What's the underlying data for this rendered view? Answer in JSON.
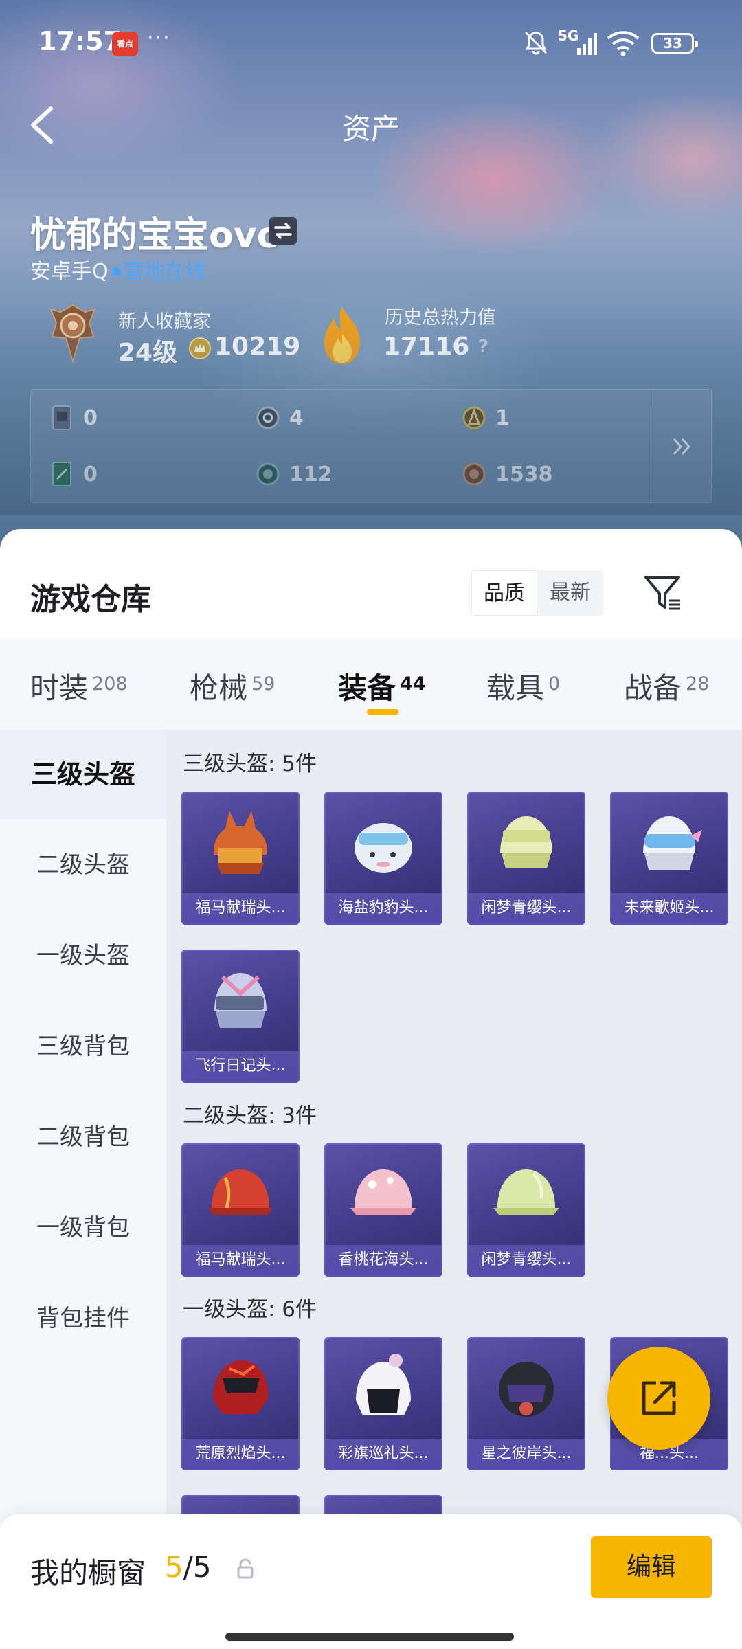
{
  "status_bar": {
    "time": "17:57",
    "app_badge": "看点",
    "more": "···",
    "network": "5G",
    "battery": "33"
  },
  "header": {
    "title": "资产"
  },
  "profile": {
    "name": "忧郁的宝宝ovo",
    "account": "安卓手Q",
    "online_status": "营地在线",
    "rank_title": "新人收藏家",
    "level": "24级",
    "coins": "10219",
    "heat_title": "历史总热力值",
    "heat_value": "17116",
    "help": "?"
  },
  "stats": [
    {
      "icon": "card-icon",
      "value": "0"
    },
    {
      "icon": "silver-coin-icon",
      "value": "4"
    },
    {
      "icon": "gold-token-icon",
      "value": "1"
    },
    {
      "icon": "green-card-icon",
      "value": "0"
    },
    {
      "icon": "teal-coin-icon",
      "value": "112"
    },
    {
      "icon": "bronze-coin-icon",
      "value": "1538"
    }
  ],
  "warehouse": {
    "title": "游戏仓库",
    "sort_options": [
      "品质",
      "最新"
    ],
    "sort_active": "品质",
    "tabs": [
      {
        "label": "时装",
        "count": "208"
      },
      {
        "label": "枪械",
        "count": "59"
      },
      {
        "label": "装备",
        "count": "44"
      },
      {
        "label": "载具",
        "count": "0"
      },
      {
        "label": "战备",
        "count": "28"
      }
    ],
    "active_tab": "装备",
    "categories": [
      "三级头盔",
      "二级头盔",
      "一级头盔",
      "三级背包",
      "二级背包",
      "一级背包",
      "背包挂件"
    ],
    "active_category": "三级头盔",
    "sections": [
      {
        "title": "三级头盔: 5件",
        "items": [
          "福马献瑞头...",
          "海盐豹豹头...",
          "闲梦青缨头...",
          "未来歌姬头...",
          "飞行日记头..."
        ]
      },
      {
        "title": "二级头盔: 3件",
        "items": [
          "福马献瑞头...",
          "香桃花海头...",
          "闲梦青缨头..."
        ]
      },
      {
        "title": "一级头盔: 6件",
        "items": [
          "荒原烈焰头...",
          "彩旗巡礼头...",
          "星之彼岸头...",
          "福...头..."
        ]
      }
    ]
  },
  "showcase": {
    "label": "我的橱窗",
    "current": "5",
    "total": "/5",
    "edit": "编辑"
  },
  "colors": {
    "accent": "#f7b500",
    "online": "#4ea6ff",
    "card": "#463f8e"
  }
}
